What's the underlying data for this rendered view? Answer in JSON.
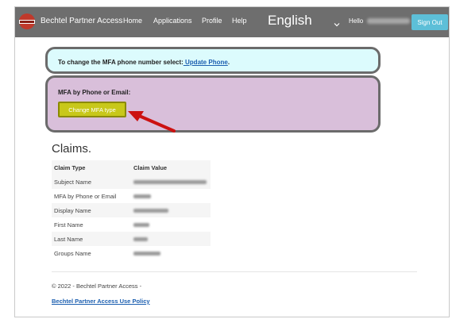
{
  "navbar": {
    "brand": "Bechtel Partner Access",
    "links": [
      "Home",
      "Applications",
      "Profile",
      "Help"
    ],
    "language": "English",
    "hello": "Hello",
    "sign_out": "Sign Out"
  },
  "mfa_phone": {
    "text": "To change the MFA phone number select:",
    "link": " Update Phone",
    "suffix": "."
  },
  "mfa_type": {
    "label": "MFA by Phone or Email:",
    "button": "Change MFA type"
  },
  "claims": {
    "title": "Claims.",
    "headers": [
      "Claim Type",
      "Claim Value"
    ],
    "rows": [
      {
        "type": "Subject Name"
      },
      {
        "type": "MFA by Phone or Email"
      },
      {
        "type": "Display Name"
      },
      {
        "type": "First Name"
      },
      {
        "type": "Last Name"
      },
      {
        "type": "Groups Name"
      }
    ]
  },
  "footer": {
    "copyright": "© 2022 - Bechtel Partner Access -",
    "policy_link": "Bechtel Partner Access Use Policy"
  },
  "colors": {
    "navbar": "#6e6e6e",
    "sign_out": "#5dbfd8",
    "phone_panel": "#dcfbfd",
    "mfa_panel": "#d9bfda",
    "mfa_button": "#c8c81a",
    "annotation_arrow": "#cc1111",
    "link": "#1c5fb0"
  },
  "icons": {
    "logo": "bechtel-logo-icon",
    "language_caret": "chevron-down-icon",
    "annotation": "red-arrow-icon"
  }
}
